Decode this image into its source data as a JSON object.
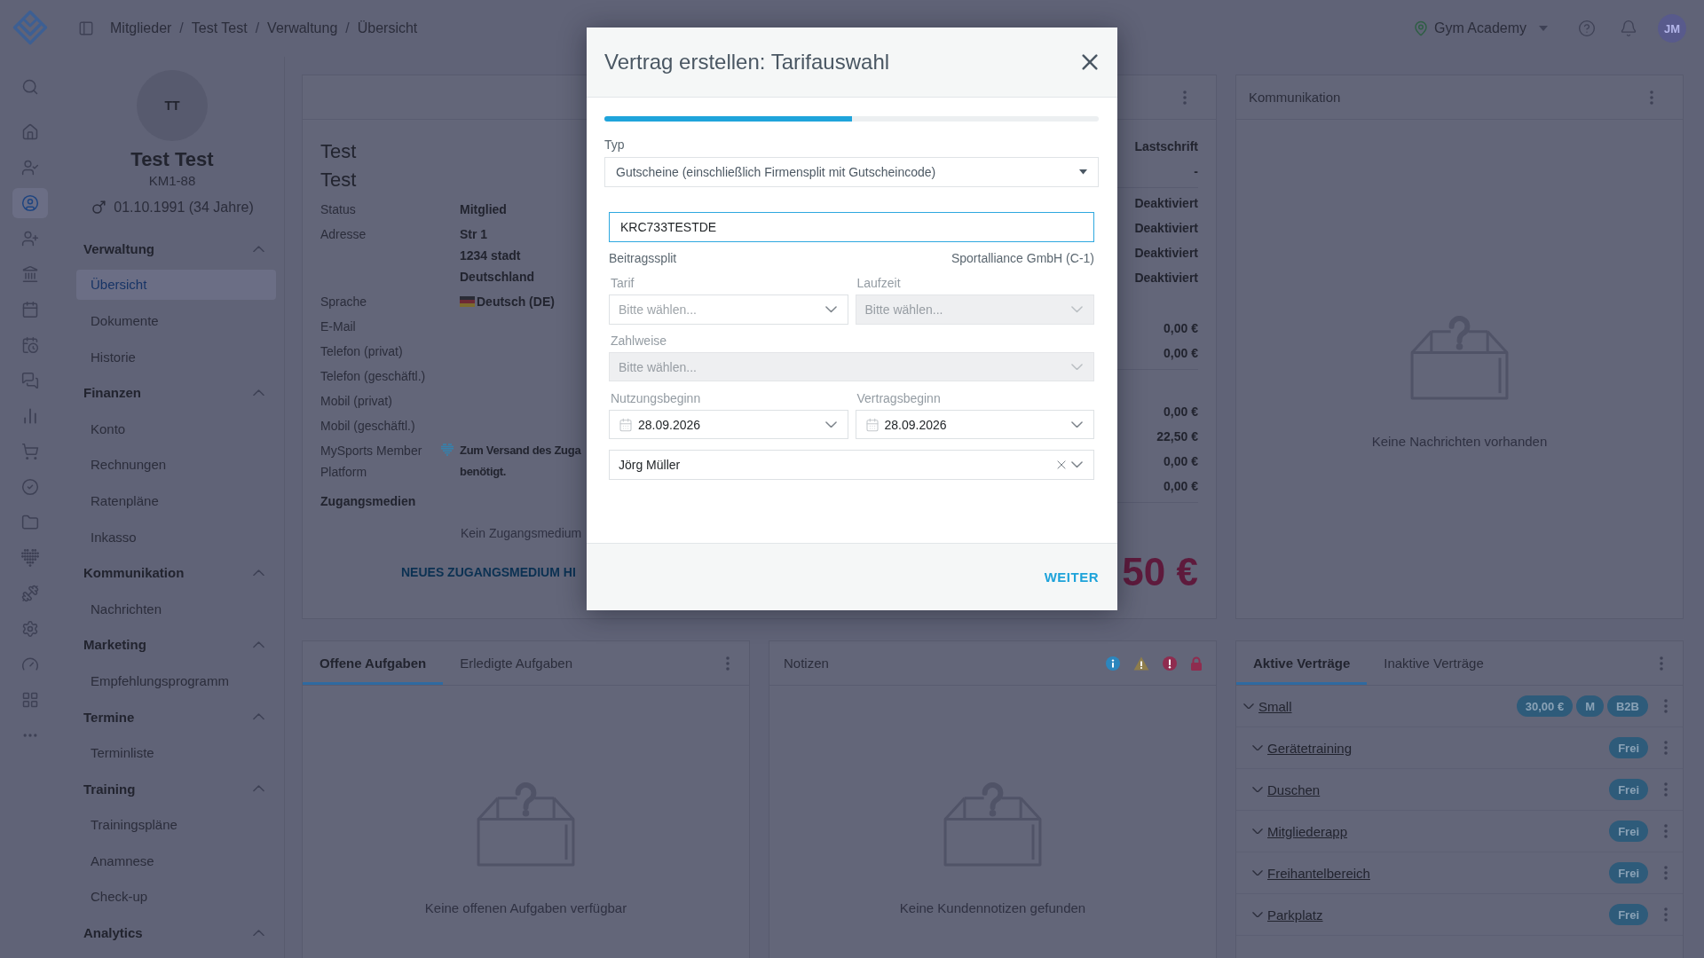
{
  "rail": [
    {
      "selected": false
    },
    {
      "selected": false
    },
    {
      "selected": false
    },
    {
      "selected": true
    },
    {
      "selected": false
    },
    {
      "selected": false
    },
    {
      "selected": false
    },
    {
      "selected": false
    },
    {
      "selected": false
    },
    {
      "selected": false
    },
    {
      "selected": false
    },
    {
      "selected": false
    },
    {
      "selected": false
    },
    {
      "selected": false
    },
    {
      "selected": false
    },
    {
      "selected": false
    },
    {
      "selected": false
    },
    {
      "selected": false
    },
    {
      "selected": false
    }
  ],
  "breadcrumb": [
    {
      "kind": "link",
      "text": "Mitglieder"
    },
    {
      "kind": "separator",
      "text": "/"
    },
    {
      "kind": "link",
      "text": "Test Test"
    },
    {
      "kind": "separator",
      "text": "/"
    },
    {
      "kind": "link",
      "text": "Verwaltung"
    },
    {
      "kind": "separator",
      "text": "/"
    },
    {
      "kind": "link",
      "text": "Übersicht"
    }
  ],
  "topbar": {
    "location": "Gym Academy",
    "user_initials": "JM"
  },
  "member": {
    "initials": "TT",
    "name": "Test Test",
    "number": "KM1-88",
    "birth": "01.10.1991 (34 Jahre)"
  },
  "menu": [
    {
      "title": "Verwaltung",
      "expanded": true,
      "items": [
        {
          "label": "Übersicht",
          "selected": true
        },
        {
          "label": "Dokumente",
          "selected": false
        },
        {
          "label": "Historie",
          "selected": false
        }
      ]
    },
    {
      "title": "Finanzen",
      "expanded": true,
      "items": [
        {
          "label": "Konto",
          "selected": false
        },
        {
          "label": "Rechnungen",
          "selected": false
        },
        {
          "label": "Ratenpläne",
          "selected": false
        },
        {
          "label": "Inkasso",
          "selected": false
        }
      ]
    },
    {
      "title": "Kommunikation",
      "expanded": true,
      "items": [
        {
          "label": "Nachrichten",
          "selected": false
        }
      ]
    },
    {
      "title": "Marketing",
      "expanded": true,
      "items": [
        {
          "label": "Empfehlungsprogramm",
          "selected": false
        }
      ]
    },
    {
      "title": "Termine",
      "expanded": true,
      "items": [
        {
          "label": "Terminliste",
          "selected": false
        }
      ]
    },
    {
      "title": "Training",
      "expanded": true,
      "items": [
        {
          "label": "Trainingspläne",
          "selected": false
        },
        {
          "label": "Anamnese",
          "selected": false
        },
        {
          "label": "Check-up",
          "selected": false
        }
      ]
    },
    {
      "title": "Analytics",
      "expanded": true
    }
  ],
  "details": {
    "names": [
      "Test",
      "Test"
    ],
    "fields": [
      {
        "label": "Status",
        "kind": "text",
        "lines": [
          "Mitglied"
        ]
      },
      {
        "label": "Adresse",
        "kind": "text",
        "lines": [
          "Str 1",
          "1234 stadt",
          "Deutschland"
        ]
      },
      {
        "label": "Sprache",
        "kind": "flag",
        "lines": [
          "Deutsch (DE)"
        ]
      },
      {
        "label": "E-Mail",
        "kind": "text"
      },
      {
        "label": "Telefon (privat)",
        "kind": "text"
      },
      {
        "label": "Telefon (geschäftl.)",
        "kind": "text"
      },
      {
        "label": "Mobil (privat)",
        "kind": "text"
      },
      {
        "label": "Mobil (geschäftl.)",
        "kind": "text"
      },
      {
        "label": "MySports Member Platform",
        "kind": "platform",
        "lines": [
          "Zum Versand des Zuga",
          "benötigt."
        ]
      }
    ],
    "access": {
      "title": "Zugangsmedien",
      "empty": "Kein Zugangsmedium",
      "add": "NEUES ZUGANGSMEDIUM HI"
    },
    "summary": [
      {
        "rows": [
          "Lastschrift",
          "-"
        ],
        "divider": true
      },
      {
        "rows": [
          "Deaktiviert",
          "Deaktiviert",
          "Deaktiviert",
          "Deaktiviert"
        ],
        "divider": false
      },
      {
        "rows": [
          "0,00 €",
          "0,00 €"
        ],
        "divider": true
      },
      {
        "rows": [
          "0,00 €",
          "22,50 €",
          "0,00 €",
          "0,00 €"
        ],
        "divider": true
      }
    ],
    "total": "50 €"
  },
  "communication": {
    "title": "Kommunikation",
    "empty": "Keine Nachrichten vorhanden"
  },
  "tasks": {
    "tabs": [
      {
        "label": "Offene Aufgaben",
        "selected": true
      },
      {
        "label": "Erledigte Aufgaben",
        "selected": false
      }
    ],
    "empty": "Keine offenen Aufgaben verfügbar"
  },
  "notes": {
    "title": "Notizen",
    "empty": "Keine Kundennotizen gefunden"
  },
  "contracts": {
    "tabs": [
      {
        "label": "Aktive Verträge",
        "selected": true
      },
      {
        "label": "Inaktive Verträge",
        "selected": false
      }
    ],
    "items": [
      {
        "name": "Small",
        "expanded": true,
        "badges": [
          "30,00 €",
          "M",
          "B2B"
        ],
        "children": [
          {
            "name": "Gerätetraining",
            "expanded": true,
            "badges": [
              "Frei"
            ]
          },
          {
            "name": "Duschen",
            "expanded": true,
            "badges": [
              "Frei"
            ]
          },
          {
            "name": "Mitgliederapp",
            "expanded": true,
            "badges": [
              "Frei"
            ]
          },
          {
            "name": "Freihantelbereich",
            "expanded": true,
            "badges": [
              "Frei"
            ]
          },
          {
            "name": "Parkplatz",
            "expanded": true,
            "badges": [
              "Frei"
            ]
          }
        ]
      }
    ]
  },
  "modal": {
    "title": "Vertrag erstellen: Tarifauswahl",
    "progress": {
      "level": 0.5
    },
    "type": {
      "label": "Typ",
      "value": "Gutscheine (einschließlich Firmensplit mit Gutscheincode)"
    },
    "voucher": {
      "value": "KRC733TESTDE",
      "focused": true
    },
    "split": {
      "label": "Beitragssplit",
      "value": "Sportalliance GmbH (C-1)"
    },
    "tariff": {
      "label": "Tarif",
      "placeholder": "Bitte wählen...",
      "disabled": false
    },
    "term": {
      "label": "Laufzeit",
      "placeholder": "Bitte wählen...",
      "disabled": true
    },
    "payment": {
      "label": "Zahlweise",
      "placeholder": "Bitte wählen...",
      "disabled": true
    },
    "dates": [
      {
        "label": "Nutzungsbeginn",
        "value": "28.09.2026"
      },
      {
        "label": "Vertragsbeginn",
        "value": "28.09.2026"
      }
    ],
    "employee": {
      "value": "Jörg Müller"
    },
    "next": "WEITER"
  }
}
